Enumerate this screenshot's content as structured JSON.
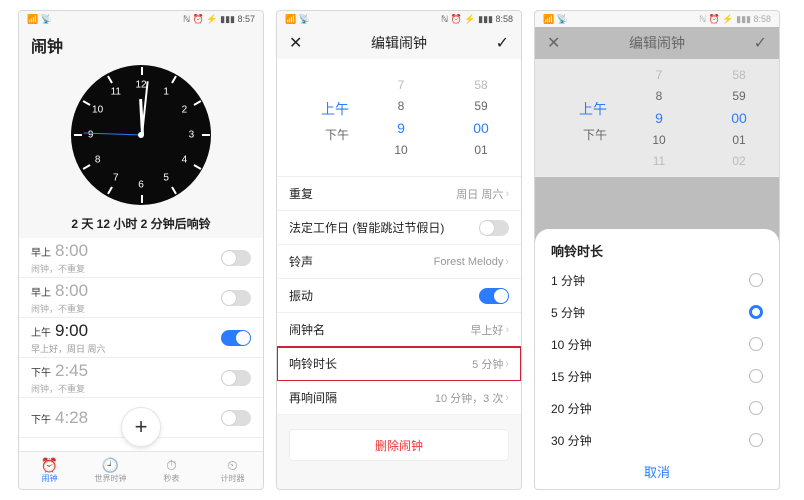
{
  "phone1": {
    "status": {
      "left": "📶 📡",
      "right": "ℕ ⏰ ⚡ ▮▮▮ 8:57"
    },
    "title": "闹钟",
    "countdown": "2 天 12 小时 2 分钟后响铃",
    "alarms": [
      {
        "ampm": "早上",
        "time": "8:00",
        "sub": "闹钟，不重复",
        "on": false
      },
      {
        "ampm": "早上",
        "time": "8:00",
        "sub": "闹钟，不重复",
        "on": false
      },
      {
        "ampm": "上午",
        "time": "9:00",
        "sub": "早上好，周日 周六",
        "on": true
      },
      {
        "ampm": "下午",
        "time": "2:45",
        "sub": "闹钟，不重复",
        "on": false
      },
      {
        "ampm": "下午",
        "time": "4:28",
        "sub": "",
        "on": false
      }
    ],
    "tabs": [
      {
        "icon": "⏰",
        "label": "闹钟",
        "active": true
      },
      {
        "icon": "🕘",
        "label": "世界时钟",
        "active": false
      },
      {
        "icon": "⏱",
        "label": "秒表",
        "active": false
      },
      {
        "icon": "⏲",
        "label": "计时器",
        "active": false
      }
    ],
    "fab": "+"
  },
  "phone2": {
    "status": {
      "left": "📶 📡",
      "right": "ℕ ⏰ ⚡ ▮▮▮ 8:58"
    },
    "title": "编辑闹钟",
    "picker": {
      "ampm": {
        "above": "",
        "sel": "上午",
        "below": "下午"
      },
      "hour": {
        "far": "7",
        "near": "8",
        "sel": "9",
        "below": "10"
      },
      "min": {
        "far": "58",
        "near": "59",
        "sel": "00",
        "below": "01"
      }
    },
    "rows": {
      "repeat_l": "重复",
      "repeat_v": "周日 周六",
      "workday_l": "法定工作日 (智能跳过节假日)",
      "ring_l": "铃声",
      "ring_v": "Forest Melody",
      "vib_l": "振动",
      "name_l": "闹钟名",
      "name_v": "早上好",
      "dur_l": "响铃时长",
      "dur_v": "5 分钟",
      "snooze_l": "再响间隔",
      "snooze_v": "10 分钟，3 次"
    },
    "delete": "删除闹钟"
  },
  "phone3": {
    "status": {
      "left": "📶 📡",
      "right": "ℕ ⏰ ⚡ ▮▮▮ 8:58"
    },
    "title": "编辑闹钟",
    "picker": {
      "ampm": {
        "sel": "上午",
        "below": "下午"
      },
      "hour": {
        "far": "7",
        "near": "8",
        "sel": "9",
        "below": "10",
        "far2": "11"
      },
      "min": {
        "far": "58",
        "near": "59",
        "sel": "00",
        "below": "01",
        "far2": "02"
      }
    },
    "sheet_title": "响铃时长",
    "options": [
      {
        "label": "1 分钟",
        "on": false
      },
      {
        "label": "5 分钟",
        "on": true
      },
      {
        "label": "10 分钟",
        "on": false
      },
      {
        "label": "15 分钟",
        "on": false
      },
      {
        "label": "20 分钟",
        "on": false
      },
      {
        "label": "30 分钟",
        "on": false
      }
    ],
    "cancel": "取消"
  }
}
